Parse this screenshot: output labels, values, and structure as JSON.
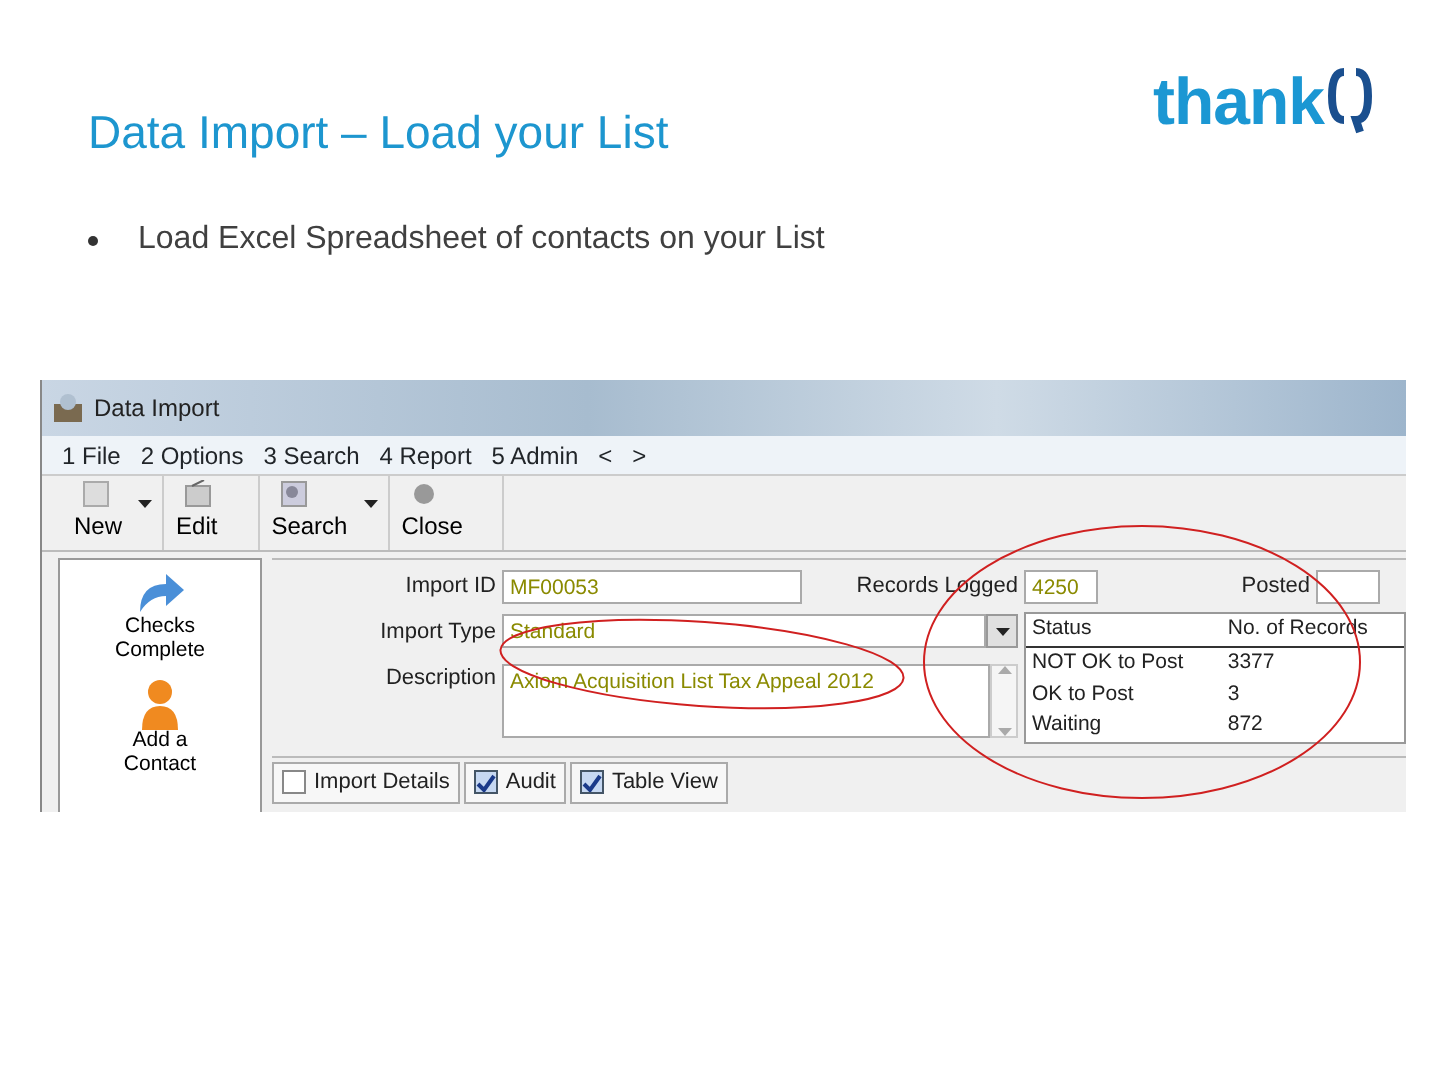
{
  "slide": {
    "title": "Data Import – Load your List",
    "logo": "thank",
    "bullets": [
      "Load Excel Spreadsheet of contacts on your List"
    ]
  },
  "window": {
    "title": "Data Import",
    "menu": [
      "1 File",
      "2 Options",
      "3 Search",
      "4 Report",
      "5 Admin",
      "<",
      ">"
    ],
    "toolbar": [
      {
        "label": "New",
        "kind": "new",
        "dropdown": true
      },
      {
        "label": "Edit",
        "kind": "edit",
        "dropdown": false
      },
      {
        "label": "Search",
        "kind": "search",
        "dropdown": true
      },
      {
        "label": "Close",
        "kind": "close",
        "dropdown": false
      }
    ],
    "sidebar": [
      {
        "label": "Checks Complete",
        "kind": "arrow"
      },
      {
        "label": "Add a Contact",
        "kind": "person"
      }
    ],
    "form": {
      "import_id_label": "Import ID",
      "import_id": "MF00053",
      "import_type_label": "Import Type",
      "import_type": "Standard",
      "description_label": "Description",
      "description": "Axiom Acquisition List Tax Appeal 2012",
      "records_logged_label": "Records Logged",
      "records_logged": "4250",
      "posted_label": "Posted"
    },
    "status_table": {
      "columns": [
        "Status",
        "No. of Records"
      ],
      "rows": [
        [
          "NOT OK to Post",
          "3377"
        ],
        [
          "OK to Post",
          "3"
        ],
        [
          "Waiting",
          "872"
        ]
      ]
    },
    "tabs": [
      {
        "label": "Import Details",
        "checked": false
      },
      {
        "label": "Audit",
        "checked": true
      },
      {
        "label": "Table View",
        "checked": true
      }
    ]
  }
}
